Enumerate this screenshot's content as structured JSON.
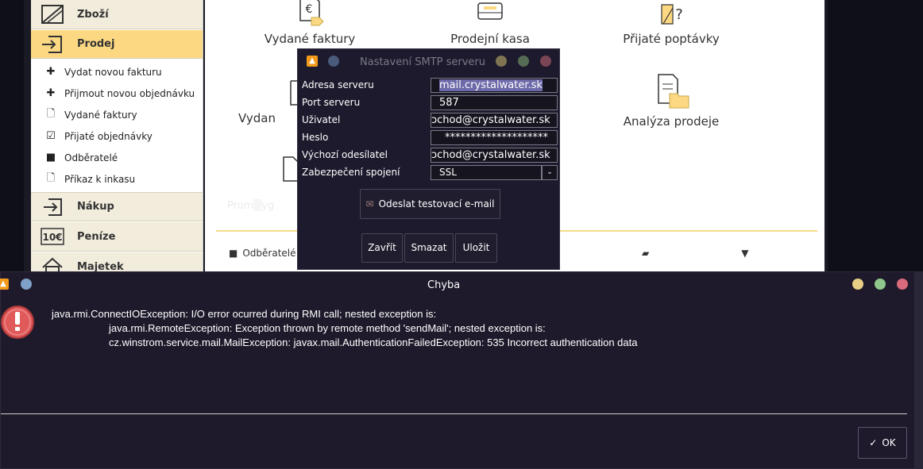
{
  "sidebar": {
    "sections": [
      {
        "label": "Zboží",
        "icon": "goods-icon"
      },
      {
        "label": "Prodej",
        "icon": "sales-icon"
      },
      {
        "label": "Nákup",
        "icon": "purchase-icon"
      },
      {
        "label": "Peníze",
        "icon": "money-icon"
      },
      {
        "label": "Majetek",
        "icon": "property-icon"
      }
    ],
    "sales_items": [
      {
        "label": "Vydat novou fakturu",
        "icon": "plus-icon"
      },
      {
        "label": "Přijmout novou objednávku",
        "icon": "plus-icon"
      },
      {
        "label": "Vydané faktury",
        "icon": "document-icon"
      },
      {
        "label": "Přijaté objednávky",
        "icon": "checklist-icon"
      },
      {
        "label": "Odběratelé",
        "icon": "folder-icon"
      },
      {
        "label": "Příkaz k inkasu",
        "icon": "document-icon"
      }
    ]
  },
  "content": {
    "tiles": [
      {
        "label": "Vydané faktury"
      },
      {
        "label": "Prodejní kasa"
      },
      {
        "label": "Přijaté poptávky"
      },
      {
        "label": "Vydan"
      },
      {
        "label": "Analýza prodeje"
      }
    ],
    "footer_label": "Odběratelé"
  },
  "smtp": {
    "title": "Nastavení SMTP serveru",
    "fields": [
      {
        "label": "Adresa serveru",
        "value": "mail.crystalwater.sk"
      },
      {
        "label": "Port serveru",
        "value": "587"
      },
      {
        "label": "Uživatel",
        "value": "ɔchod@crystalwater.sk"
      },
      {
        "label": "Heslo",
        "value": "********************"
      },
      {
        "label": "Výchozí odesílatel",
        "value": "ɔchod@crystalwater.sk"
      },
      {
        "label": "Zabezpečení spojení",
        "value": "SSL"
      }
    ],
    "test_button": "Odeslat testovací e-mail",
    "buttons": {
      "close": "Zavřít",
      "delete": "Smazat",
      "save": "Uložit"
    }
  },
  "error": {
    "title": "Chyba",
    "lines": [
      "java.rmi.ConnectIOException: I/O error ocurred during RMI call; nested exception is:",
      "java.rmi.RemoteException: Exception thrown by remote method 'sendMail'; nested exception is:",
      "cz.winstrom.service.mail.MailException: javax.mail.AuthenticationFailedException: 535 Incorrect authentication data"
    ],
    "ok_label": "OK"
  },
  "colors": {
    "accent_active": "#fcd882",
    "dialog_bg": "#1e1a2b",
    "error_red": "#e05a5a",
    "title_arrow": "#f39a1b"
  }
}
